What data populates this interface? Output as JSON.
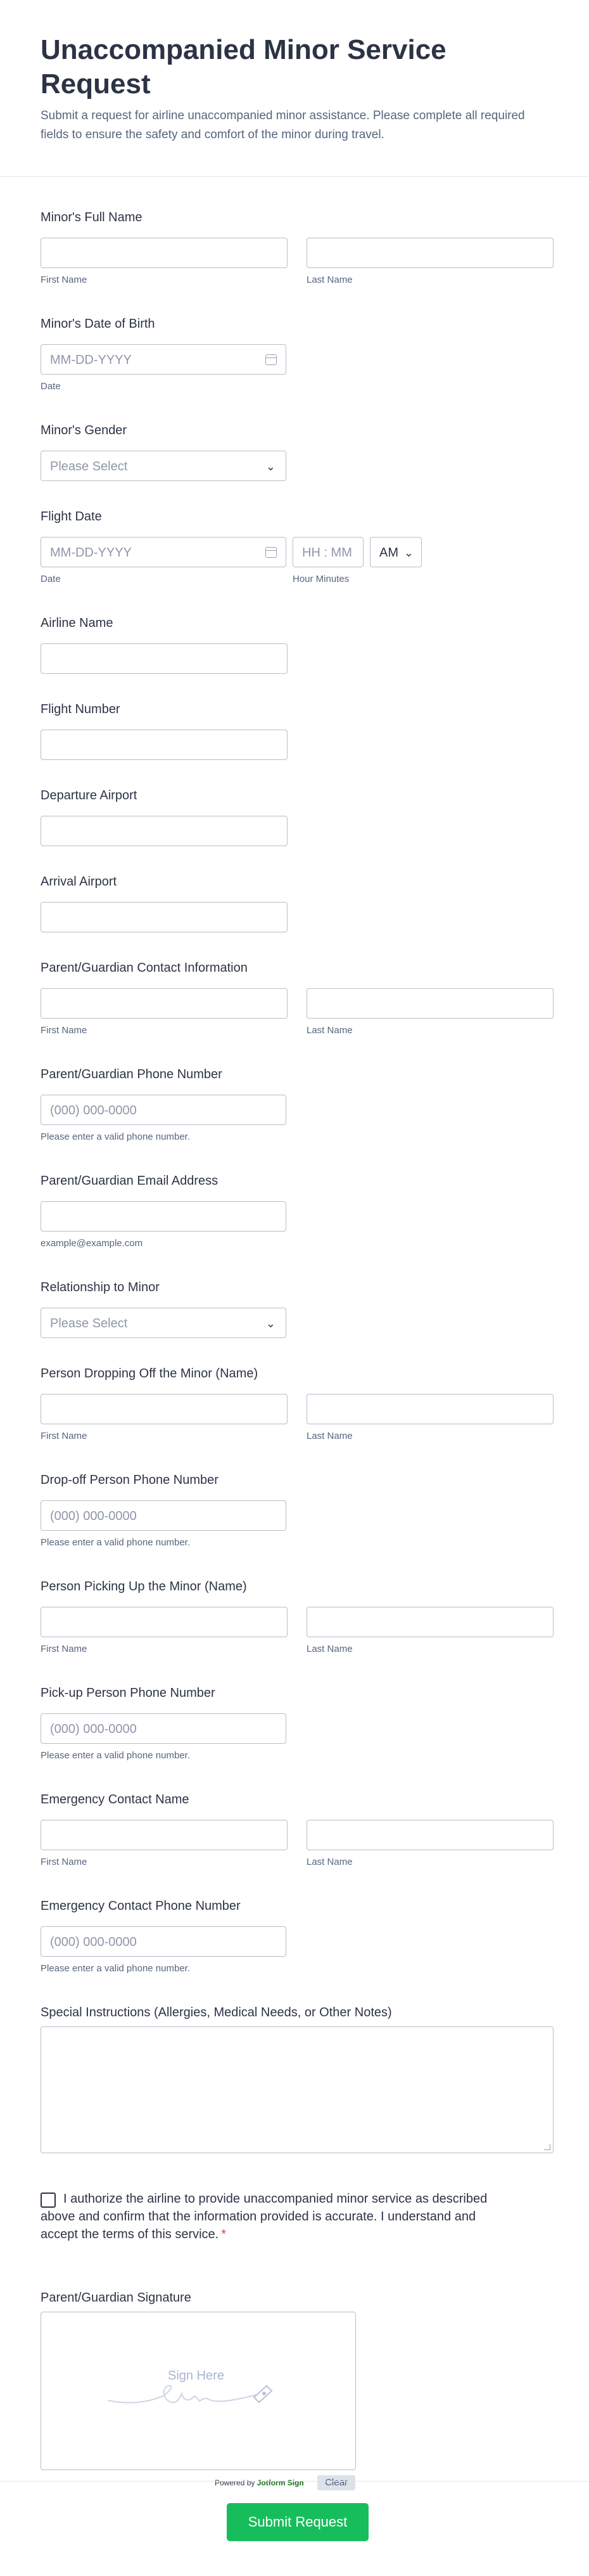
{
  "header": {
    "title": "Unaccompanied Minor Service Request",
    "subtitle": "Submit a request for airline unaccompanied minor assistance. Please complete all required fields to ensure the safety and comfort of the minor during travel."
  },
  "minor_name": {
    "label": "Minor's Full Name",
    "first_sub": "First Name",
    "last_sub": "Last Name"
  },
  "minor_dob": {
    "label": "Minor's Date of Birth",
    "placeholder": "MM-DD-YYYY",
    "sub": "Date"
  },
  "minor_gender": {
    "label": "Minor's Gender",
    "value": "Please Select"
  },
  "flight_date": {
    "label": "Flight Date",
    "date_placeholder": "MM-DD-YYYY",
    "time_placeholder": "HH : MM",
    "ampm": "AM",
    "date_sub": "Date",
    "time_sub": "Hour Minutes"
  },
  "airline_name": {
    "label": "Airline Name"
  },
  "flight_number": {
    "label": "Flight Number"
  },
  "departure_airport": {
    "label": "Departure Airport"
  },
  "arrival_airport": {
    "label": "Arrival Airport"
  },
  "guardian_name": {
    "label": "Parent/Guardian Contact Information",
    "first_sub": "First Name",
    "last_sub": "Last Name"
  },
  "guardian_phone": {
    "label": "Parent/Guardian Phone Number",
    "placeholder": "(000) 000-0000",
    "sub": "Please enter a valid phone number."
  },
  "guardian_email": {
    "label": "Parent/Guardian Email Address",
    "sub": "example@example.com"
  },
  "relationship": {
    "label": "Relationship to Minor",
    "value": "Please Select"
  },
  "dropoff_name": {
    "label": "Person Dropping Off the Minor (Name)",
    "first_sub": "First Name",
    "last_sub": "Last Name"
  },
  "dropoff_phone": {
    "label": "Drop-off Person Phone Number",
    "placeholder": "(000) 000-0000",
    "sub": "Please enter a valid phone number."
  },
  "pickup_name": {
    "label": "Person Picking Up the Minor (Name)",
    "first_sub": "First Name",
    "last_sub": "Last Name"
  },
  "pickup_phone": {
    "label": "Pick-up Person Phone Number",
    "placeholder": "(000) 000-0000",
    "sub": "Please enter a valid phone number."
  },
  "emergency_name": {
    "label": "Emergency Contact Name",
    "first_sub": "First Name",
    "last_sub": "Last Name"
  },
  "emergency_phone": {
    "label": "Emergency Contact Phone Number",
    "placeholder": "(000) 000-0000",
    "sub": "Please enter a valid phone number."
  },
  "special_instructions": {
    "label": "Special Instructions (Allergies, Medical Needs, or Other Notes)"
  },
  "consent": {
    "text": "I authorize the airline to provide unaccompanied minor service as described above and confirm that the information provided is accurate. I understand and accept the terms of this service.",
    "required_mark": "*"
  },
  "signature": {
    "label": "Parent/Guardian Signature",
    "placeholder": "Sign Here",
    "powered_prefix": "Powered by",
    "powered_brand": "Jotform Sign",
    "clear_label": "Clear"
  },
  "footer": {
    "submit_label": "Submit Request"
  },
  "colors": {
    "submit": "#18bd5b",
    "required": "#f23a3c",
    "text": "#2c3345",
    "border": "#b8bdc9"
  }
}
